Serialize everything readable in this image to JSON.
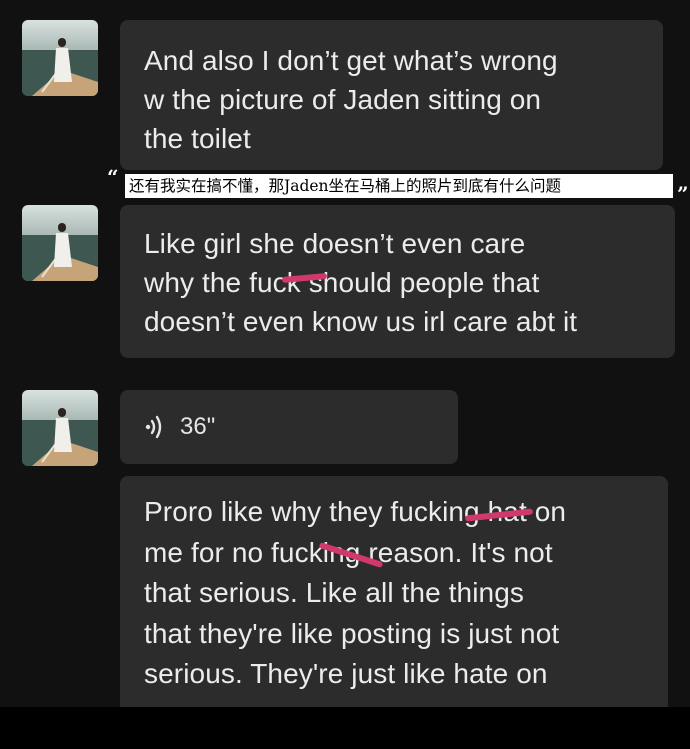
{
  "messages": [
    {
      "type": "text",
      "text_lines": [
        "And also I don’t get what’s wrong",
        "w the picture of Jaden sitting on",
        "the toilet"
      ]
    },
    {
      "type": "text",
      "text_lines": [
        "Like girl she doesn’t even care",
        "why the fuck should people that",
        "doesn’t even know us irl care abt it"
      ]
    },
    {
      "type": "voice",
      "duration": "36\""
    },
    {
      "type": "text",
      "text_lines": [
        "Proro like why they fucking hat on",
        "me for no fucking reason. It's not",
        "that serious. Like all the things",
        "that they're like posting is just not",
        "serious. They're just like hate on"
      ]
    }
  ],
  "translation": {
    "open_quote": "“",
    "close_quote": "”",
    "text": "还有我实在搞不懂，那Jaden坐在马桶上的照片到底有什么问题"
  },
  "colors": {
    "background": "#111111",
    "bubble": "#2c2c2c",
    "text": "#ececec",
    "strike": "#d1386d"
  }
}
